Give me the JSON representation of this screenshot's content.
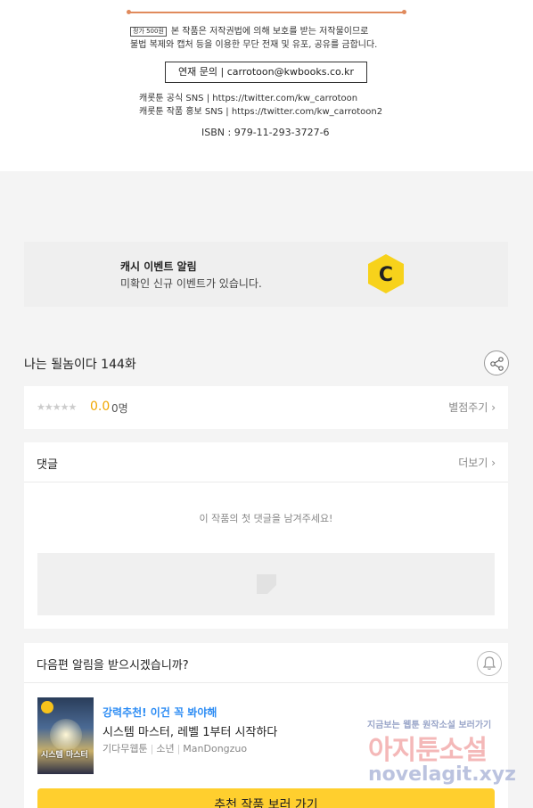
{
  "copyright": {
    "price_badge": "정가 500원",
    "legal_line1": "본 작품은 저작권법에 의해 보호를 받는 저작물이므로",
    "legal_line2": "불법 복제와 캡처 등을 이용한 무단 전재 및 유포, 공유를 금합니다.",
    "contact": "연재 문의 | carrotoon@kwbooks.co.kr",
    "sns1": "캐롯툰 공식 SNS | https://twitter.com/kw_carrotoon",
    "sns2": "캐롯툰 작품 홍보 SNS | https://twitter.com/kw_carrotoon2",
    "isbn": "ISBN : 979-11-293-3727-6"
  },
  "event": {
    "title": "캐시 이벤트 알림",
    "subtitle": "미확인 신규 이벤트가 있습니다.",
    "coin_letter": "C",
    "coin_color": "#f7d21b"
  },
  "episode": {
    "title": "나는 될놈이다 144화",
    "share_icon": "share-icon"
  },
  "rating": {
    "stars": "★★★★★",
    "score": "0.0",
    "count": "0명",
    "rate_label": "별점주기 ›"
  },
  "comments": {
    "label": "댓글",
    "more_label": "더보기 ›",
    "empty_text": "이 작품의 첫 댓글을 남겨주세요!"
  },
  "notify": {
    "question": "다음편 알림을 받으시겠습니까?",
    "bell_icon": "bell-icon"
  },
  "recommend": {
    "tag": "강력추천! 이건 꼭 봐야해",
    "title": "시스템 마스터, 레벨 1부터 시작하다",
    "genre": "기다무웹툰",
    "category": "소년",
    "author": "ManDongzuo",
    "thumb_text": "시스템 마스터",
    "button": "추천 작품 보러 가기"
  },
  "watermark": {
    "line1": "지금보는 웹툰 원작소설 보러가기",
    "line2": "아지툰소설",
    "line3": "novelagit.xyz"
  }
}
